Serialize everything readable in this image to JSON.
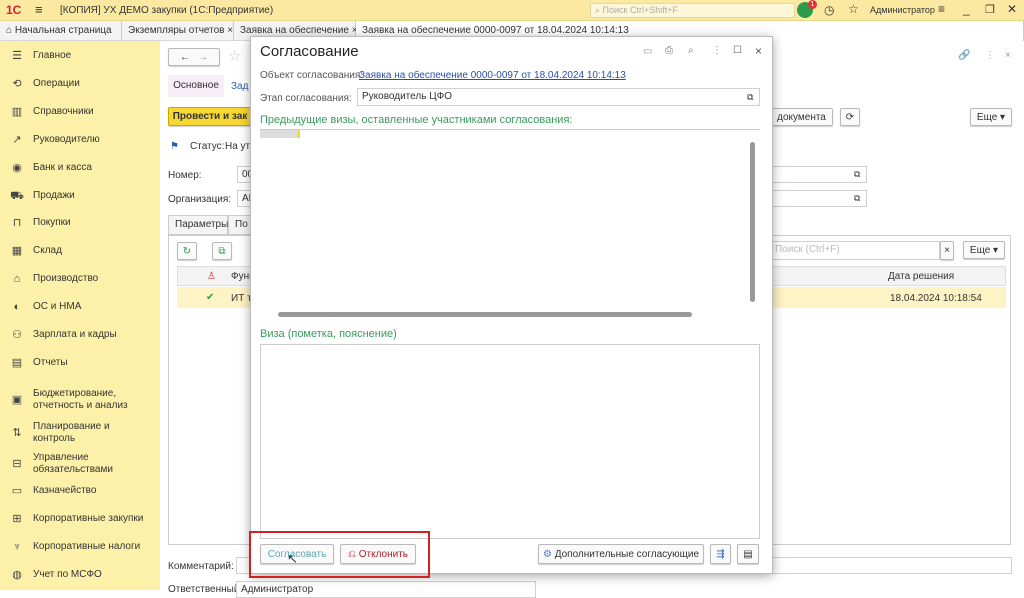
{
  "app": {
    "title": "[КОПИЯ] УХ ДЕМО закупки  (1С:Предприятие)",
    "search_placeholder": "Поиск Ctrl+Shift+F",
    "user": "Администратор",
    "notification_count": "1"
  },
  "tabs": [
    {
      "label": "Начальная страница"
    },
    {
      "label": "Экземпляры отчетов"
    },
    {
      "label": "Заявка на обеспечение"
    },
    {
      "label": "Заявка на обеспечение 0000-0097 от 18.04.2024 10:14:13"
    }
  ],
  "sidebar": {
    "items": [
      {
        "label": "Главное",
        "icon": "menu-icon"
      },
      {
        "label": "Операции",
        "icon": "cycle-icon"
      },
      {
        "label": "Справочники",
        "icon": "book-icon"
      },
      {
        "label": "Руководителю",
        "icon": "trend-icon"
      },
      {
        "label": "Банк и касса",
        "icon": "coin-icon"
      },
      {
        "label": "Продажи",
        "icon": "cart-icon"
      },
      {
        "label": "Покупки",
        "icon": "basket-icon"
      },
      {
        "label": "Склад",
        "icon": "warehouse-icon"
      },
      {
        "label": "Производство",
        "icon": "factory-icon"
      },
      {
        "label": "ОС и НМА",
        "icon": "assets-icon"
      },
      {
        "label": "Зарплата и кадры",
        "icon": "people-icon"
      },
      {
        "label": "Отчеты",
        "icon": "report-icon"
      },
      {
        "label": "Бюджетирование, отчетность и анализ",
        "icon": "budget-icon"
      },
      {
        "label": "Планирование и контроль",
        "icon": "plan-icon"
      },
      {
        "label": "Управление обязательствами",
        "icon": "briefcase-icon"
      },
      {
        "label": "Казначейство",
        "icon": "treasury-icon"
      },
      {
        "label": "Корпоративные закупки",
        "icon": "gift-icon"
      },
      {
        "label": "Корпоративные налоги",
        "icon": "tax-icon"
      },
      {
        "label": "Учет по МСФО",
        "icon": "globe-icon"
      }
    ]
  },
  "doc": {
    "tab_main": "Основное",
    "tab_tasks": "Зад",
    "post_close": "Провести и зак",
    "status_label": "Статус:",
    "status_value": "На ут",
    "number_label": "Номер:",
    "number_value": "00",
    "org_label": "Организация:",
    "org_value": "АБ",
    "subtab_params": "Параметры",
    "subtab_other": "По",
    "doc_button": "документа",
    "more": "Еще",
    "search_placeholder": "Поиск (Ctrl+F)",
    "col_func": "Функ",
    "col_date": "Дата решения",
    "row_func": "ИТ т",
    "row_date": "18.04.2024 10:18:54",
    "comment_label": "Комментарий:",
    "responsible_label": "Ответственный:",
    "responsible_value": "Администратор"
  },
  "dialog": {
    "title": "Согласование",
    "object_label": "Объект согласования:",
    "object_link": "Заявка на обеспечение 0000-0097 от 18.04.2024 10:14:13",
    "stage_label": "Этап согласования:",
    "stage_value": "Руководитель ЦФО",
    "prev_visas_label": "Предыдущие визы, оставленные участниками согласования:",
    "visa_label": "Виза (пометка, пояснение)",
    "approve": "Согласовать",
    "reject": "Отклонить",
    "extra_approvers": "Дополнительные согласующие"
  },
  "colors": {
    "topbar": "#fbe9a2",
    "sidebar": "#fdf1a9",
    "accent_green": "#3a9b5c",
    "highlight_red": "#d32020",
    "primary_button": "#f7d731",
    "selected_row": "#fdf3c4"
  }
}
